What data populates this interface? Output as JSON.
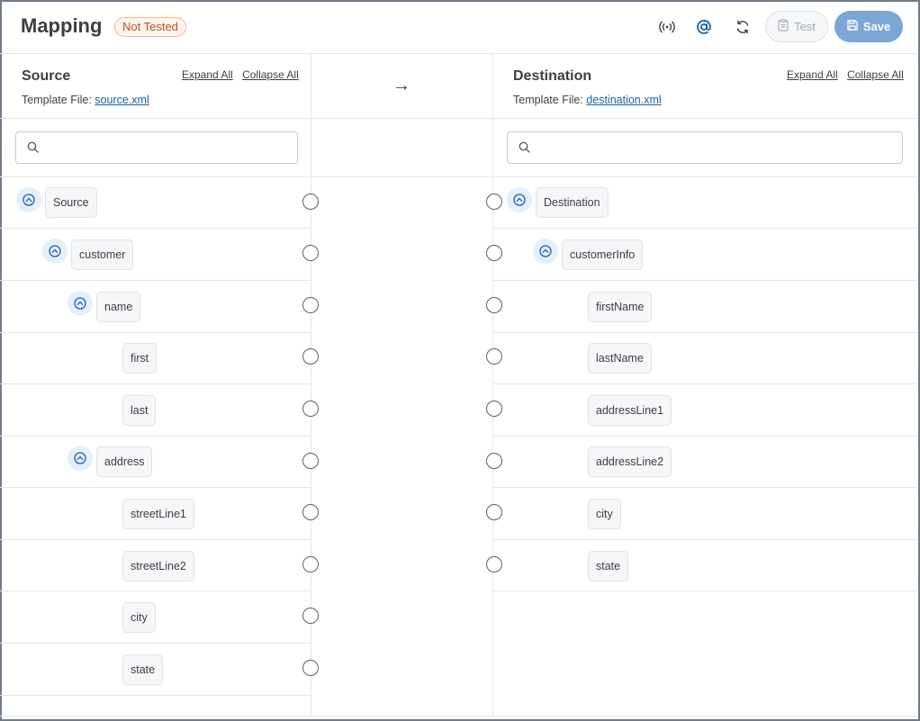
{
  "header": {
    "title": "Mapping",
    "status_badge": "Not Tested",
    "icons": [
      "broadcast-icon",
      "at-sign-icon",
      "refresh-icon"
    ],
    "test_label": "Test",
    "save_label": "Save"
  },
  "source": {
    "title": "Source",
    "expand_all": "Expand All",
    "collapse_all": "Collapse All",
    "template_label": "Template File:",
    "template_file": "source.xml",
    "search_placeholder": "",
    "nodes": [
      {
        "label": "Source",
        "collapsible": true
      },
      {
        "label": "customer",
        "collapsible": true
      },
      {
        "label": "name",
        "collapsible": true
      },
      {
        "label": "first",
        "collapsible": false
      },
      {
        "label": "last",
        "collapsible": false
      },
      {
        "label": "address",
        "collapsible": true
      },
      {
        "label": "streetLine1",
        "collapsible": false
      },
      {
        "label": "streetLine2",
        "collapsible": false
      },
      {
        "label": "city",
        "collapsible": false
      },
      {
        "label": "state",
        "collapsible": false
      }
    ]
  },
  "mapping": {
    "arrow": "→"
  },
  "destination": {
    "title": "Destination",
    "expand_all": "Expand All",
    "collapse_all": "Collapse All",
    "template_label": "Template File:",
    "template_file": "destination.xml",
    "search_placeholder": "",
    "nodes": [
      {
        "label": "Destination",
        "collapsible": true
      },
      {
        "label": "customerInfo",
        "collapsible": true
      },
      {
        "label": "firstName",
        "collapsible": false
      },
      {
        "label": "lastName",
        "collapsible": false
      },
      {
        "label": "addressLine1",
        "collapsible": false
      },
      {
        "label": "addressLine2",
        "collapsible": false
      },
      {
        "label": "city",
        "collapsible": false
      },
      {
        "label": "state",
        "collapsible": false
      }
    ]
  },
  "colors": {
    "accent": "#1a5fa8",
    "save_button": "#7aa7d4",
    "badge_text": "#b4552a",
    "badge_bg": "#fff3ec",
    "toggle_bg": "#e3f0fb"
  }
}
